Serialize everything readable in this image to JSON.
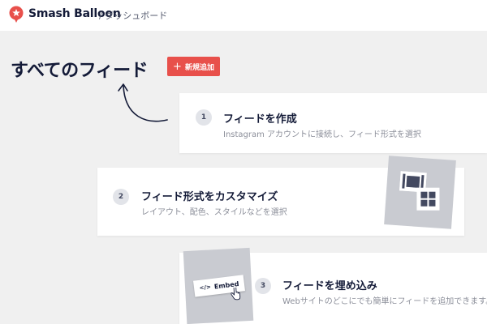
{
  "header": {
    "brand": "Smash Balloon",
    "breadcrumb": "/ ダッシュボード",
    "brand_color": "#e8504b"
  },
  "page": {
    "title": "すべてのフィード",
    "add_button_label": "新規追加",
    "accent_color": "#e8504b"
  },
  "steps": [
    {
      "number": "1",
      "title": "フィードを作成",
      "description": "Instagram アカウントに接続し、フィード形式を選択"
    },
    {
      "number": "2",
      "title": "フィード形式をカスタマイズ",
      "description": "レイアウト、配色、スタイルなどを選択"
    },
    {
      "number": "3",
      "title": "フィードを埋め込み",
      "description": "Webサイトのどこにでも簡単にフィードを追加できます。"
    }
  ],
  "illustrations": {
    "embed_code": "</>",
    "embed_label": "Embed",
    "icons": [
      "curved-arrow-icon",
      "film-icon",
      "grid-icon",
      "hand-cursor-icon",
      "balloon-logo-icon",
      "plus-icon"
    ]
  }
}
